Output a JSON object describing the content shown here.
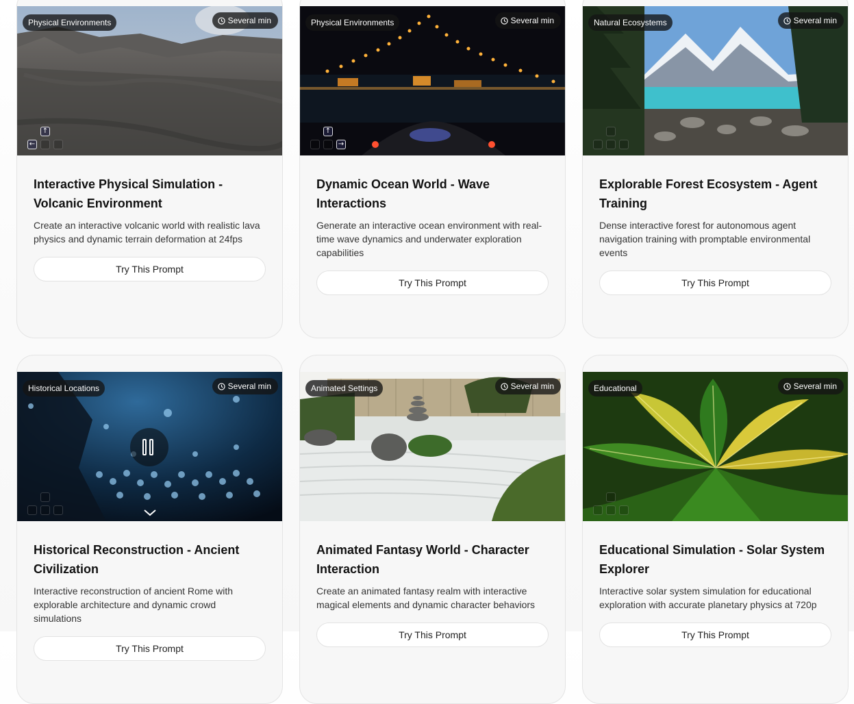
{
  "cards": [
    {
      "tag": "Physical Environments",
      "duration": "Several min",
      "title": "Interactive Physical Simulation - Volcanic Environment",
      "description": "Create an interactive volcanic world with realistic lava physics and dynamic terrain deformation at 24fps",
      "button": "Try This Prompt",
      "keys": {
        "up": "↑",
        "left": "←",
        "down": "",
        "right": ""
      }
    },
    {
      "tag": "Physical Environments",
      "duration": "Several min",
      "title": "Dynamic Ocean World - Wave Interactions",
      "description": "Generate an interactive ocean environment with real-time wave dynamics and underwater exploration capabilities",
      "button": "Try This Prompt",
      "keys": {
        "up": "↑",
        "left": "",
        "down": "",
        "right": "→"
      }
    },
    {
      "tag": "Natural Ecosystems",
      "duration": "Several min",
      "title": "Explorable Forest Ecosystem - Agent Training",
      "description": "Dense interactive forest for autonomous agent navigation training with promptable environmental events",
      "button": "Try This Prompt",
      "keys": {
        "up": "",
        "left": "",
        "down": "",
        "right": ""
      }
    },
    {
      "tag": "Historical Locations",
      "duration": "Several min",
      "title": "Historical Reconstruction - Ancient Civilization",
      "description": "Interactive reconstruction of ancient Rome with explorable architecture and dynamic crowd simulations",
      "button": "Try This Prompt",
      "keys": {
        "up": "",
        "left": "",
        "down": "",
        "right": ""
      }
    },
    {
      "tag": "Animated Settings",
      "duration": "Several min",
      "title": "Animated Fantasy World - Character Interaction",
      "description": "Create an animated fantasy realm with interactive magical elements and dynamic character behaviors",
      "button": "Try This Prompt",
      "keys": {
        "up": "",
        "left": "",
        "down": "",
        "right": ""
      }
    },
    {
      "tag": "Educational",
      "duration": "Several min",
      "title": "Educational Simulation - Solar System Explorer",
      "description": "Interactive solar system simulation for educational exploration with accurate planetary physics at 720p",
      "button": "Try This Prompt",
      "keys": {
        "up": "",
        "left": "",
        "down": "",
        "right": ""
      }
    }
  ],
  "icons": {
    "duration": "clock-icon",
    "pause": "pause-icon",
    "expand": "chevron-down-icon"
  },
  "colors": {
    "card_bg": "#f7f7f7",
    "card_border": "#e4e4e4",
    "badge_bg": "#141414",
    "button_bg": "#ffffff"
  }
}
